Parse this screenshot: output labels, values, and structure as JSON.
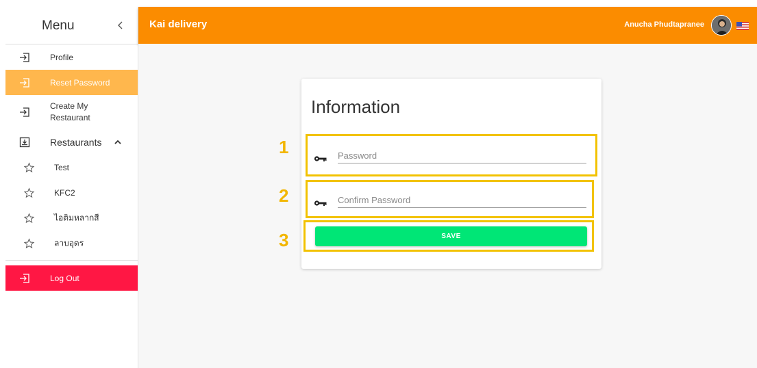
{
  "sidebar": {
    "title": "Menu",
    "items": [
      {
        "label": "Profile",
        "icon": "login-arrow-icon"
      },
      {
        "label": "Reset Password",
        "icon": "login-arrow-icon",
        "active": true
      },
      {
        "label": "Create My Restaurant",
        "icon": "login-arrow-icon"
      },
      {
        "label": "Restaurants",
        "icon": "download-box-icon"
      }
    ],
    "restaurants": [
      "Test",
      "KFC2",
      "ไอติมหลากสี",
      "ลาบอุดร"
    ],
    "logout_label": "Log Out"
  },
  "topbar": {
    "brand": "Kai delivery",
    "username": "Anucha Phudtapranee"
  },
  "card": {
    "title": "Information",
    "password_placeholder": "Password",
    "confirm_placeholder": "Confirm Password",
    "save_label": "SAVE"
  },
  "annotations": [
    "1",
    "2",
    "3"
  ],
  "colors": {
    "topbar": "#fb8c00",
    "active_item": "#ffb74d",
    "logout": "#ff1744",
    "save": "#00e676",
    "annotation": "#f2c200"
  }
}
